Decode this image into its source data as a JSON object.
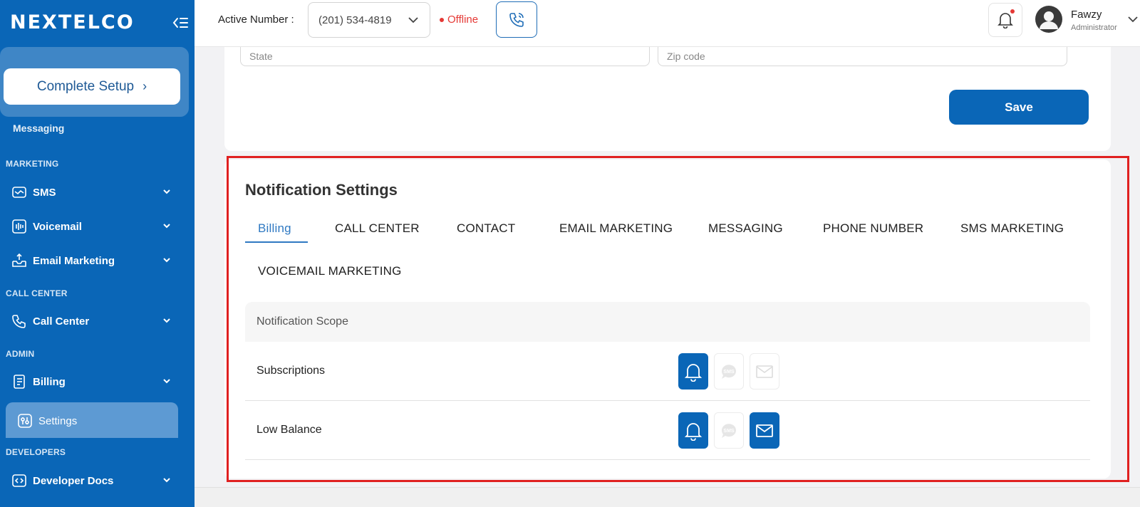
{
  "brand": {
    "logo_text": "NEXTELCO"
  },
  "sidebar": {
    "setup_button": "Complete Setup",
    "partial_item": "Messaging",
    "sections": {
      "marketing": "MARKETING",
      "call_center": "CALL CENTER",
      "admin": "ADMIN",
      "developers": "DEVELOPERS"
    },
    "items": {
      "sms": "SMS",
      "voicemail": "Voicemail",
      "email_marketing": "Email Marketing",
      "call_center": "Call Center",
      "billing": "Billing",
      "settings": "Settings",
      "developer_docs": "Developer Docs"
    }
  },
  "header": {
    "active_number_label": "Active Number :",
    "active_number_value": "(201) 534-4819",
    "status": "Offline",
    "user": {
      "name": "Fawzy",
      "role": "Administrator"
    }
  },
  "address_form": {
    "state_placeholder": "State",
    "zip_placeholder": "Zip code",
    "save_label": "Save"
  },
  "notifications": {
    "title": "Notification Settings",
    "tabs": [
      "Billing",
      "CALL CENTER",
      "CONTACT",
      "EMAIL MARKETING",
      "MESSAGING",
      "PHONE NUMBER",
      "SMS MARKETING",
      "VOICEMAIL MARKETING"
    ],
    "active_tab": "Billing",
    "table_header": "Notification Scope",
    "sms_icon_text": "SMS",
    "rows": [
      {
        "label": "Subscriptions",
        "push": true,
        "sms": false,
        "email": false
      },
      {
        "label": "Low Balance",
        "push": true,
        "sms": false,
        "email": true
      }
    ]
  },
  "colors": {
    "primary": "#0a66b7",
    "sidebar": "#0a66b7",
    "offline": "#e53935",
    "highlight": "#e02020"
  }
}
